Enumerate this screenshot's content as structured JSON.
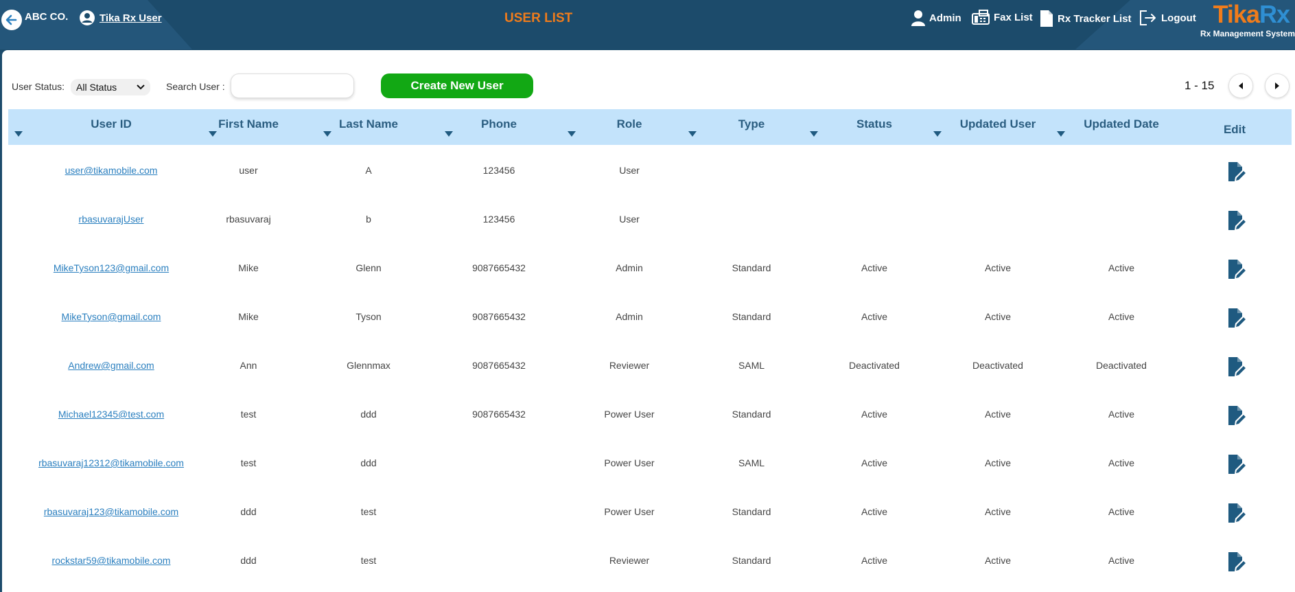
{
  "header": {
    "company": "ABC CO.",
    "user_link": "Tika Rx User",
    "page_title": "USER LIST",
    "nav": {
      "admin": "Admin",
      "fax_list": "Fax List",
      "rx_tracker": "Rx Tracker List",
      "logout": "Logout"
    },
    "brand": {
      "tika": "Tika",
      "rx": "Rx",
      "subtitle": "Rx Management System"
    }
  },
  "toolbar": {
    "status_label": "User Status:",
    "status_value": "All Status",
    "search_label": "Search User :",
    "search_value": "",
    "create_label": "Create New User",
    "range": "1 - 15"
  },
  "table": {
    "columns": [
      "User ID",
      "First Name",
      "Last Name",
      "Phone",
      "Role",
      "Type",
      "Status",
      "Updated User",
      "Updated Date",
      "Edit"
    ],
    "rows": [
      [
        "user@tikamobile.com",
        "user",
        "A",
        "123456",
        "User",
        "",
        "",
        "",
        ""
      ],
      [
        "rbasuvarajUser",
        "rbasuvaraj",
        "b",
        "123456",
        "User",
        "",
        "",
        "",
        ""
      ],
      [
        "MikeTyson123@gmail.com",
        "Mike",
        "Glenn",
        "9087665432",
        "Admin",
        "Standard",
        "Active",
        "Active",
        "Active"
      ],
      [
        "MikeTyson@gmail.com",
        "Mike",
        "Tyson",
        "9087665432",
        "Admin",
        "Standard",
        "Active",
        "Active",
        "Active"
      ],
      [
        "Andrew@gmail.com",
        "Ann",
        "Glennmax",
        "9087665432",
        "Reviewer",
        "SAML",
        "Deactivated",
        "Deactivated",
        "Deactivated"
      ],
      [
        "Michael12345@test.com",
        "test",
        "ddd",
        "9087665432",
        "Power User",
        "Standard",
        "Active",
        "Active",
        "Active"
      ],
      [
        "rbasuvaraj12312@tikamobile.com",
        "test",
        "ddd",
        "",
        "Power User",
        "SAML",
        "Active",
        "Active",
        "Active"
      ],
      [
        "rbasuvaraj123@tikamobile.com",
        "ddd",
        "test",
        "",
        "Power User",
        "Standard",
        "Active",
        "Active",
        "Active"
      ],
      [
        "rockstar59@tikamobile.com",
        "ddd",
        "test",
        "",
        "Reviewer",
        "Standard",
        "Active",
        "Active",
        "Active"
      ]
    ]
  },
  "colors": {
    "header_bg": "#1c4b6b",
    "title_orange": "#f07c1b",
    "table_header_bg": "#c3e3fb",
    "create_green": "#12a814",
    "link_blue": "#2a7fbf",
    "edit_icon": "#1f5a80"
  },
  "icons": [
    "arrow-left-icon",
    "user-circle-icon",
    "admin-user-icon",
    "fax-icon",
    "document-icon",
    "logout-icon",
    "chevron-down-icon",
    "caret-left-icon",
    "caret-right-icon",
    "sort-caret-icon",
    "edit-document-icon"
  ]
}
